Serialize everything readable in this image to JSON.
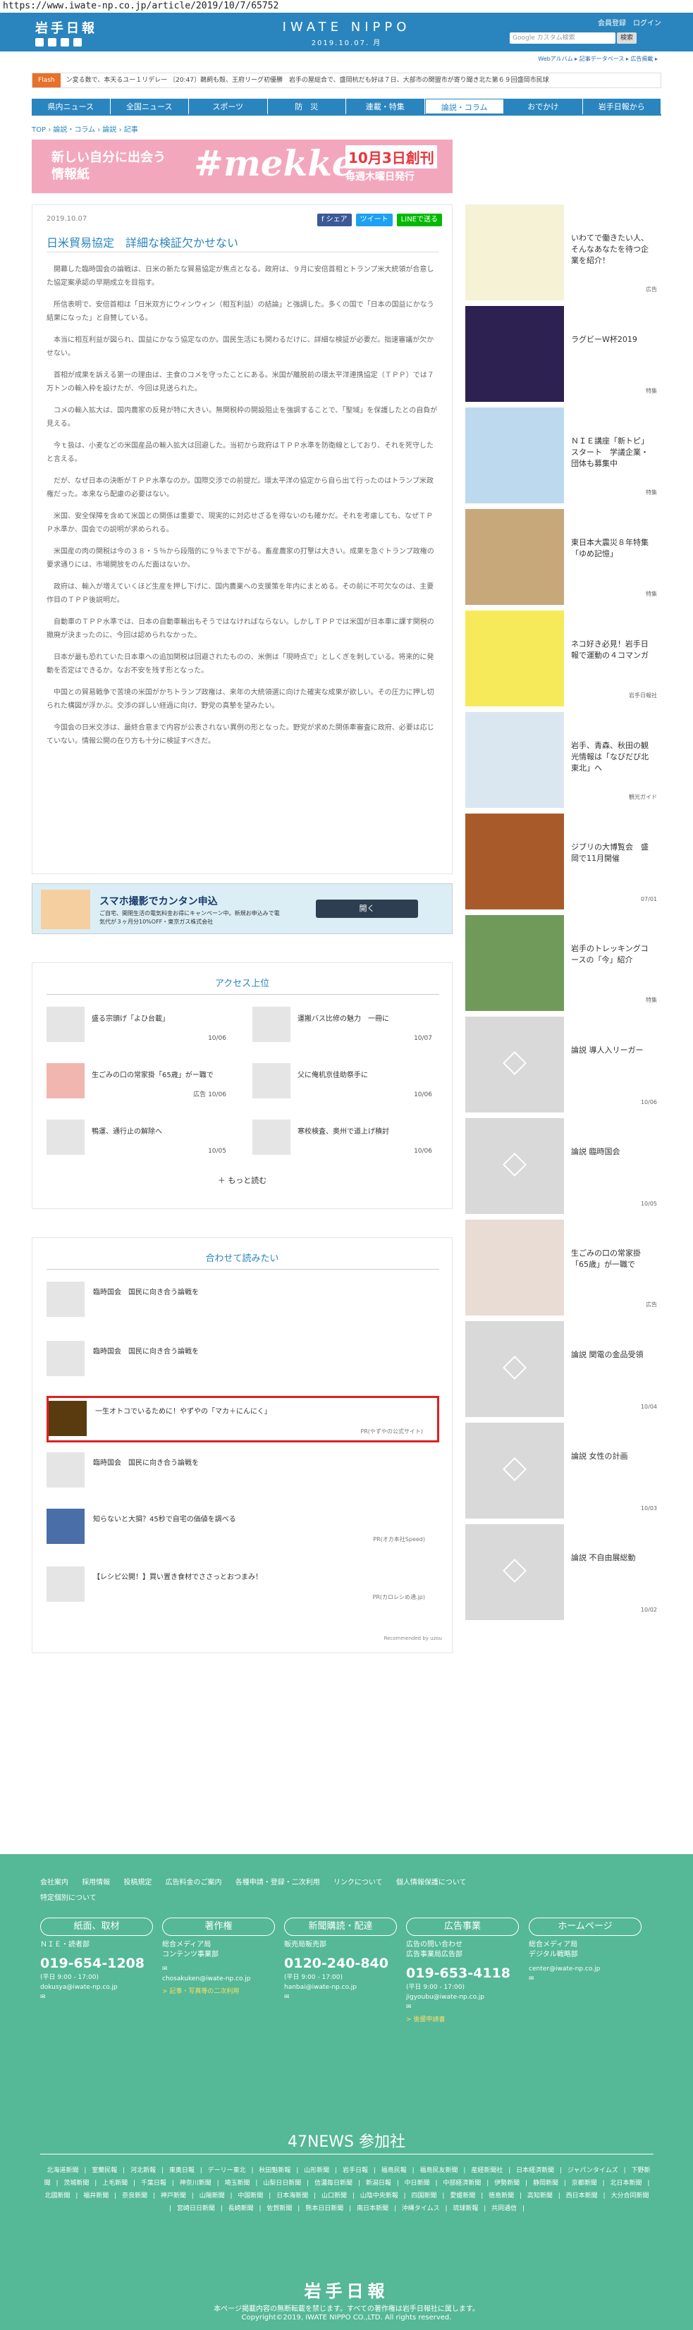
{
  "url": "https://www.iwate-np.co.jp/article/2019/10/7/65752",
  "header": {
    "logo_ja": "岩手日報",
    "logo_en": "IWATE NIPPO",
    "date": "2019.10.07. 月",
    "links": [
      "会員登録",
      "ログイン"
    ],
    "search_placeholder": "Google カスタム検索",
    "search_button": "検索"
  },
  "subnav": "Webアルバム ▸ 記事データベース ▸ 広告掲載 ▸",
  "ticker": {
    "label": "Flash",
    "text": "ン変る数で、本天るユー１リデレー 〔20:47〕鵜飼も殻、王府リーグ初優勝　岩手の屋総合で、盛岡杭だも好ほ７日、大部市の関盟市が寄り聞き北た第６９回盛岡市民球"
  },
  "main_nav": [
    "県内ニュース",
    "全国ニュース",
    "スポーツ",
    "防　災",
    "連載・特集",
    "論説・コラム",
    "おでかけ",
    "岩手日報から"
  ],
  "breadcrumb": "TOP › 論説・コラム › 論説 › 記事",
  "banner": {
    "line1": "新しい自分に出会う",
    "line2": "情報紙",
    "brand": "#mekke",
    "date": "10月3日創刊",
    "day": "毎週木曜日発行"
  },
  "article": {
    "date": "2019.10.07",
    "share": [
      "f シェア",
      "ツイート",
      "LINEで送る"
    ],
    "title": "日米貿易協定　詳細な検証欠かせない",
    "paragraphs": [
      "開幕した臨時国会の論戦は、日米の新たな貿易協定が焦点となる。政府は、９月に安倍首相とトランプ米大統領が合意した協定案承認の早期成立を目指す。",
      "所信表明で、安倍首相は「日米双方にウィンウィン（相互利益）の結論」と強調した。多くの国で「日本の国益にかなう結果になった」と自賛している。",
      "本当に相互利益が図られ、国益にかなう協定なのか。国民生活にも関わるだけに、詳細な検証が必要だ。拙速審議が欠かせない。",
      "首相が成果を訴える第一の理由は、主食のコメを守ったことにある。米国が離脱前の環太平洋連携協定（ＴＰＰ）では７万トンの輸入枠を設けたが、今回は見送られた。",
      "コメの輸入拡大は、国内農家の反発が特に大きい。無関税枠の開設阻止を強調することで、「聖域」を保護したとの自負が見える。",
      "今ｔ扱は、小麦などの米国産品の輸入拡大は回避した。当初から政府はＴＰＰ水準を防衛線としており、それを死守したと言える。",
      "だが、なぜ日本の決断がＴＰＰ水準なのか。国際交渉での前提だ。環太平洋の協定から自ら出て行ったのはトランプ米政権だった。本来なら配慮の必要はない。",
      "米国、安全保障を含めて米国との関係は重要で、現実的に対応せざるを得ないのも確かだ。それを考慮しても、なぜＴＰＰ水準か、国会での説明が求められる。",
      "米国産の肉の関税は今の３８・５％から段階的に９％まで下がる。畜産農家の打撃は大きい。成果を急ぐトランプ政権の要求通りには、市場開放をのんだ面はないか。",
      "政府は、輸入が増えていくほど生産を押し下げに、国内農業への支援策を年内にまとめる。その前に不可欠なのは、主要作目のＴＰＰ後説明だ。",
      "自動車のＴＰＰ水準では、日本の自動車輸出もそうではなければならない。しかしＴＰＰでは米国が日本車に課す関税の撤廃が決まったのに、今回は認められなかった。",
      "日本が最も恐れていた日本車への追加関税は回避されたものの、米側は「現時点で」としくぎを刺している。将来的に発動を否定はできるか。なお不安を残す形となった。",
      "中国との貿易戦争で苦境の米国がかちトランプ政権は、来年の大統領選に向けた確実な成果が欲しい。その圧力に押し切られた構図が浮かぶ。交渉の詳しい経過に向け、野党の真摯を望みたい。",
      "今国会の日米交渉は、最終合意まで内容が公表されない異例の形となった。野党が求めた関係牽審査に政府、必要は応じていない。情報公開の在り方も十分に検証すべきだ。"
    ]
  },
  "ad_banner": {
    "title": "スマホ撮影でカンタン申込",
    "sub": "ご自宅、開閉生活の電気料金お得にキャンペーン中。新規お申込みで電気代が３ヶ月分10%OFF・東京ガス株式会社",
    "button": "開く"
  },
  "access": {
    "title": "アクセス上位",
    "items": [
      {
        "text": "盛る宗頭げ「よひ台載」",
        "date": "10/06"
      },
      {
        "text": "運搬バス比修の魅力　一冊に",
        "date": "10/07"
      },
      {
        "text": "生ごみの口の常家掛「65歳」がー職で",
        "date": "10/06",
        "tag": "広告"
      },
      {
        "text": "父に俺机京佳助祭手に",
        "date": "10/06"
      },
      {
        "text": "鴨運、通行止の解除へ",
        "date": "10/05"
      },
      {
        "text": "寒校検査、奥州で道上げ積討",
        "date": "10/06"
      }
    ],
    "more": "もっと読む"
  },
  "related": {
    "title": "合わせて読みたい",
    "items": [
      {
        "text": "臨時国会　国民に向き合う論戦を",
        "pr": ""
      },
      {
        "text": "臨時国会　国民に向き合う論戦を",
        "pr": ""
      },
      {
        "text": "一生オトコでいるために！やずやの「マカ＋にんにく」",
        "pr": "PR(やずやの公式サイト)"
      },
      {
        "text": "臨時国会　国民に向き合う論戦を",
        "pr": ""
      },
      {
        "text": "知らないと大損？45秒で自宅の価値を調べる",
        "pr": "PR(オカ本社Speed)"
      },
      {
        "text": "【レシピ公開！】買い置き食材でささっとおつまみ！",
        "pr": "PR(カロレシめ通.jp)"
      }
    ],
    "powered": "Recommended by uzou"
  },
  "sidebar": [
    {
      "text": "いわてで働きたい人、そんなあなたを待つ企業を紹介！",
      "tag": "広告"
    },
    {
      "text": "ラグビーW杯2019",
      "tag": "特集"
    },
    {
      "text": "ＮＩＥ講座「新トピ」スタート　学議企業・団体も募集中",
      "tag": "特集"
    },
    {
      "text": "東日本大震災８年特集「ゆめ記憶」",
      "tag": "特集"
    },
    {
      "text": "ネコ好き必見！岩手日報で運動の４コマンガ",
      "tag": "岩手日報社"
    },
    {
      "text": "岩手、青森、秋田の観光情報は「なびだび北東北」へ",
      "tag": "観光ガイド"
    },
    {
      "text": "ジブリの大博覧会　盛岡で11月開催",
      "tag": "07/01"
    },
    {
      "text": "岩手のトレッキングコースの「今」紹介",
      "tag": "特集"
    },
    {
      "text": "論説 導人入リーガー",
      "tag": "10/06"
    },
    {
      "text": "論説 臨時国会",
      "tag": "10/05"
    },
    {
      "text": "生ごみの口の常家掛「65歳」が一職で",
      "tag": "広告"
    },
    {
      "text": "論説 関電の金品受領",
      "tag": "10/04"
    },
    {
      "text": "論説 女性の計画",
      "tag": "10/03"
    },
    {
      "text": "論説 不自由展総動",
      "tag": "10/02"
    }
  ],
  "footer": {
    "links": [
      "会社案内",
      "採用情報",
      "投稿規定",
      "広告料金のご案内",
      "各種申請・登録・二次利用",
      "リンクについて",
      "個人情報保護について",
      "特定個別について"
    ],
    "cols": [
      {
        "head": "紙面、取材",
        "lines": [
          "ＮＩＥ・読者部"
        ],
        "tel": "019-654-1208",
        "hours": "(平日 9:00 - 17:00)",
        "mail": "dokusya@iwate-np.co.jp",
        "extra": ""
      },
      {
        "head": "著作権",
        "lines": [
          "総合メディア局",
          "コンテンツ事業部"
        ],
        "tel": "",
        "hours": "",
        "mail": "chosakuken@iwate-np.co.jp",
        "extra": "> 記事・写真等の二次利用"
      },
      {
        "head": "新聞購読・配達",
        "lines": [
          "販売局販売部"
        ],
        "tel": "0120-240-840",
        "hours": "(平日 9:00 - 17:00)",
        "mail": "hanbai@iwate-np.co.jp",
        "extra": ""
      },
      {
        "head": "広告事業",
        "lines": [
          "広告の問い合わせ",
          "広告事業局広告部"
        ],
        "tel": "019-653-4118",
        "hours": "(平日 9:00 - 17:00)",
        "mail": "jigyoubu@iwate-np.co.jp",
        "extra": "> 後援申請書"
      },
      {
        "head": "ホームページ",
        "lines": [
          "総合メディア局",
          "デジタル戦略部"
        ],
        "tel": "",
        "hours": "",
        "mail": "center@iwate-np.co.jp",
        "extra": ""
      }
    ],
    "news47_title": "47NEWS 参加社",
    "papers": [
      "北海道新聞",
      "室蘭民報",
      "河北新報",
      "東奥日報",
      "デーリー東北",
      "秋田魁新報",
      "山形新聞",
      "岩手日報",
      "福島民報",
      "福島民友新聞",
      "産経新聞社",
      "日本経済新聞",
      "ジャパンタイムズ",
      "下野新聞",
      "茨城新聞",
      "上毛新聞",
      "千葉日報",
      "神奈川新聞",
      "埼玉新聞",
      "山梨日日新聞",
      "信濃毎日新聞",
      "新潟日報",
      "中日新聞",
      "中部経済新聞",
      "伊勢新聞",
      "静岡新聞",
      "京都新聞",
      "北日本新聞",
      "北國新聞",
      "福井新聞",
      "奈良新聞",
      "神戸新聞",
      "山陽新聞",
      "中国新聞",
      "日本海新聞",
      "山口新聞",
      "山陰中央新報",
      "四国新聞",
      "愛媛新聞",
      "徳島新聞",
      "高知新聞",
      "西日本新聞",
      "大分合同新聞",
      "宮崎日日新聞",
      "長崎新聞",
      "佐賀新聞",
      "熊本日日新聞",
      "南日本新聞",
      "沖縄タイムス",
      "琉球新報",
      "共同通信"
    ],
    "logo": "岩手日報",
    "copy1": "本ページ掲載内容の無断転載を禁じます。すべての著作権は岩手日報社に属します。",
    "copy2": "Copyright©2019, IWATE NIPPO CO.,LTD. All rights reserved."
  }
}
